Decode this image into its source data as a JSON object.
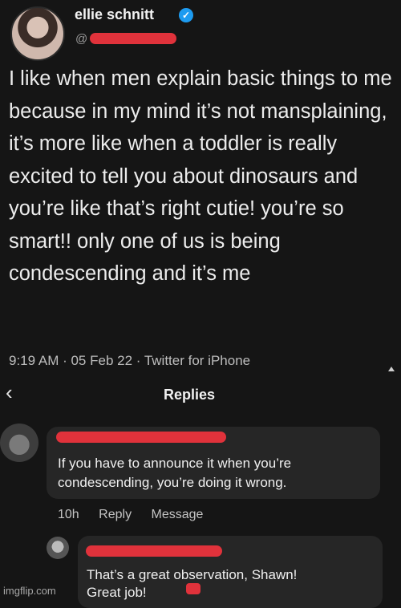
{
  "tweet": {
    "author_name": "ellie schnitt",
    "handle_prefix": "@",
    "body": "I like when men explain basic things to me because in my mind it’s not mansplaining, it’s more like when a toddler is really excited to tell you about dinosaurs and you’re like that’s right cutie! you’re so smart!! only one of us is being condescending and it’s me",
    "meta": "9:19 AM · 05 Feb 22 · Twitter for iPhone"
  },
  "replies": {
    "title": "Replies",
    "back_icon": "‹",
    "comments": [
      {
        "text": "If you have to announce it when you’re condescending, you’re doing it wrong.",
        "time": "10h",
        "reply_label": "Reply",
        "message_label": "Message"
      },
      {
        "text_line1": "That’s a great observation, Shawn!",
        "text_line2": "Great job!"
      }
    ]
  },
  "watermark": "imgflip.com",
  "colors": {
    "redaction": "#e0323b",
    "verified": "#1d9bf0",
    "background": "#151515",
    "bubble": "#262626"
  }
}
